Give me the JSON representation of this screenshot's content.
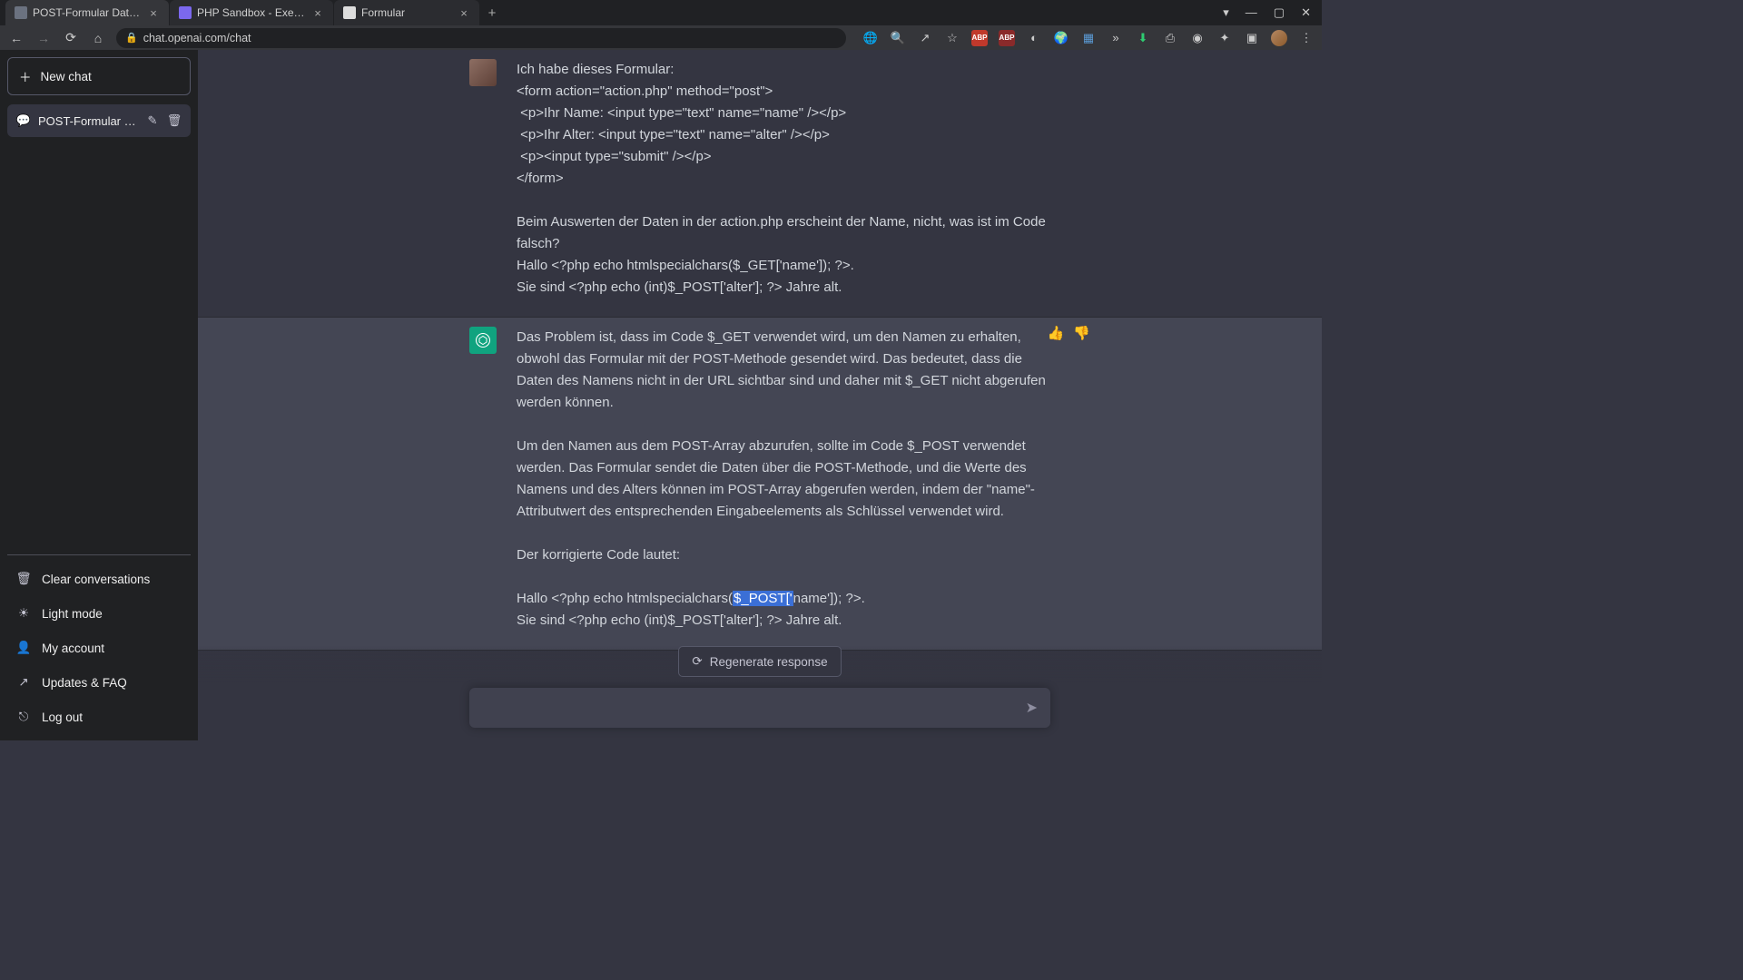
{
  "browser": {
    "tabs": [
      {
        "title": "POST-Formular Daten verarbeit…"
      },
      {
        "title": "PHP Sandbox - Execute PHP cod…"
      },
      {
        "title": "Formular"
      }
    ],
    "url": "chat.openai.com/chat",
    "ext_badges": {
      "a": "ABP",
      "b": "ABP"
    }
  },
  "sidebar": {
    "new_chat": "New chat",
    "conversation": "POST-Formular Daten v",
    "bottom": {
      "clear": "Clear conversations",
      "light": "Light mode",
      "account": "My account",
      "updates": "Updates & FAQ",
      "logout": "Log out"
    }
  },
  "messages": {
    "user": {
      "text": "Ich habe dieses Formular:\n<form action=\"action.php\" method=\"post\">\n <p>Ihr Name: <input type=\"text\" name=\"name\" /></p>\n <p>Ihr Alter: <input type=\"text\" name=\"alter\" /></p>\n <p><input type=\"submit\" /></p>\n</form>\n\nBeim Auswerten der Daten in der action.php erscheint der Name, nicht, was ist im Code falsch?\nHallo <?php echo htmlspecialchars($_GET['name']); ?>.\nSie sind <?php echo (int)$_POST['alter']; ?> Jahre alt."
    },
    "assistant": {
      "p1": "Das Problem ist, dass im Code $_GET verwendet wird, um den Namen zu erhalten, obwohl das Formular mit der POST-Methode gesendet wird. Das bedeutet, dass die Daten des Namens nicht in der URL sichtbar sind und daher mit $_GET nicht abgerufen werden können.",
      "p2": "Um den Namen aus dem POST-Array abzurufen, sollte im Code $_POST verwendet werden. Das Formular sendet die Daten über die POST-Methode, und die Werte des Namens und des Alters können im POST-Array abgerufen werden, indem der \"name\"-Attributwert des entsprechenden Eingabeelements als Schlüssel verwendet wird.",
      "p3": "Der korrigierte Code lautet:",
      "code_pre": "Hallo <?php echo htmlspecialchars(",
      "code_hl": "$_POST['",
      "code_post": "name']); ?>.",
      "code_line2": "Sie sind <?php echo (int)$_POST['alter']; ?> Jahre alt."
    }
  },
  "footer": {
    "regenerate": "Regenerate response",
    "placeholder": ""
  }
}
